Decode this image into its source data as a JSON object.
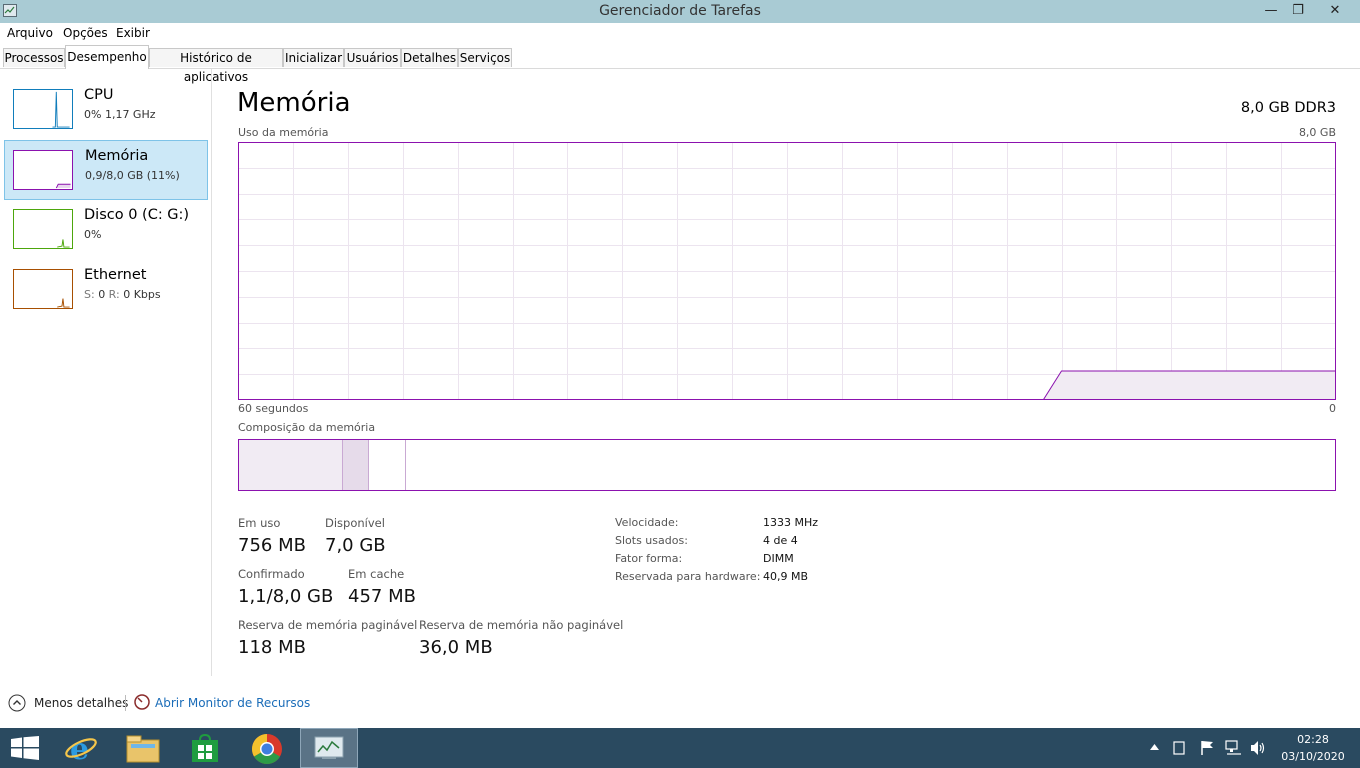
{
  "window": {
    "title": "Gerenciador de Tarefas",
    "close_glyph": "✕",
    "maximize_glyph": "❐",
    "minimize_glyph": "—"
  },
  "menu": [
    "Arquivo",
    "Opções",
    "Exibir"
  ],
  "tabs": [
    "Processos",
    "Desempenho",
    "Histórico de aplicativos",
    "Inicializar",
    "Usuários",
    "Detalhes",
    "Serviços"
  ],
  "active_tab": "Desempenho",
  "resources": [
    {
      "name": "CPU",
      "sub": "0%  1,17 GHz",
      "color": "#117dbb"
    },
    {
      "name": "Memória",
      "sub": "0,9/8,0 GB (11%)",
      "color": "#8b12ae"
    },
    {
      "name": "Disco 0 (C: G:)",
      "sub": "0%",
      "color": "#4da60c"
    },
    {
      "name": "Ethernet",
      "sub_prefix": "S: ",
      "sub_s": "0",
      "sub_r_label": " R: ",
      "sub_r": "0 Kbps",
      "color": "#a74f01"
    }
  ],
  "main": {
    "title": "Memória",
    "capacity": "8,0 GB DDR3",
    "usage_label": "Uso da memória",
    "usage_max": "8,0 GB",
    "time_left": "60 segundos",
    "time_right": "0",
    "composition_label": "Composição da memória",
    "accent": "#8b12ae"
  },
  "chart_data": {
    "type": "area",
    "title": "Uso da memória",
    "x_label_left": "60 segundos",
    "x_label_right": "0",
    "y_max_label": "8,0 GB",
    "x": [
      60,
      16,
      15,
      0
    ],
    "values_gb": [
      0,
      0,
      0.9,
      0.9
    ],
    "ylim": [
      0,
      8
    ],
    "grid": true
  },
  "composition": {
    "in_use_fraction": 0.094,
    "modified_fraction": 0.023,
    "standby_fraction": 0.033
  },
  "stats": {
    "em_uso_label": "Em uso",
    "em_uso": "756 MB",
    "disponivel_label": "Disponível",
    "disponivel": "7,0 GB",
    "confirmado_label": "Confirmado",
    "confirmado": "1,1/8,0 GB",
    "em_cache_label": "Em cache",
    "em_cache": "457 MB",
    "paginavel_label": "Reserva de memória paginável",
    "paginavel": "118 MB",
    "nao_paginavel_label": "Reserva de memória não paginável",
    "nao_paginavel": "36,0 MB"
  },
  "details": [
    {
      "label": "Velocidade:",
      "value": "1333 MHz"
    },
    {
      "label": "Slots usados:",
      "value": "4 de 4"
    },
    {
      "label": "Fator forma:",
      "value": "DIMM"
    },
    {
      "label": "Reservada para hardware:",
      "value": "40,9 MB"
    }
  ],
  "footer": {
    "fewer_details": "Menos detalhes",
    "resource_monitor": "Abrir Monitor de Recursos"
  },
  "taskbar": {
    "apps": [
      "start-icon",
      "internet-explorer-icon",
      "file-explorer-icon",
      "store-icon",
      "chrome-icon",
      "task-manager-icon"
    ],
    "clock_time": "02:28",
    "clock_date": "03/10/2020"
  }
}
